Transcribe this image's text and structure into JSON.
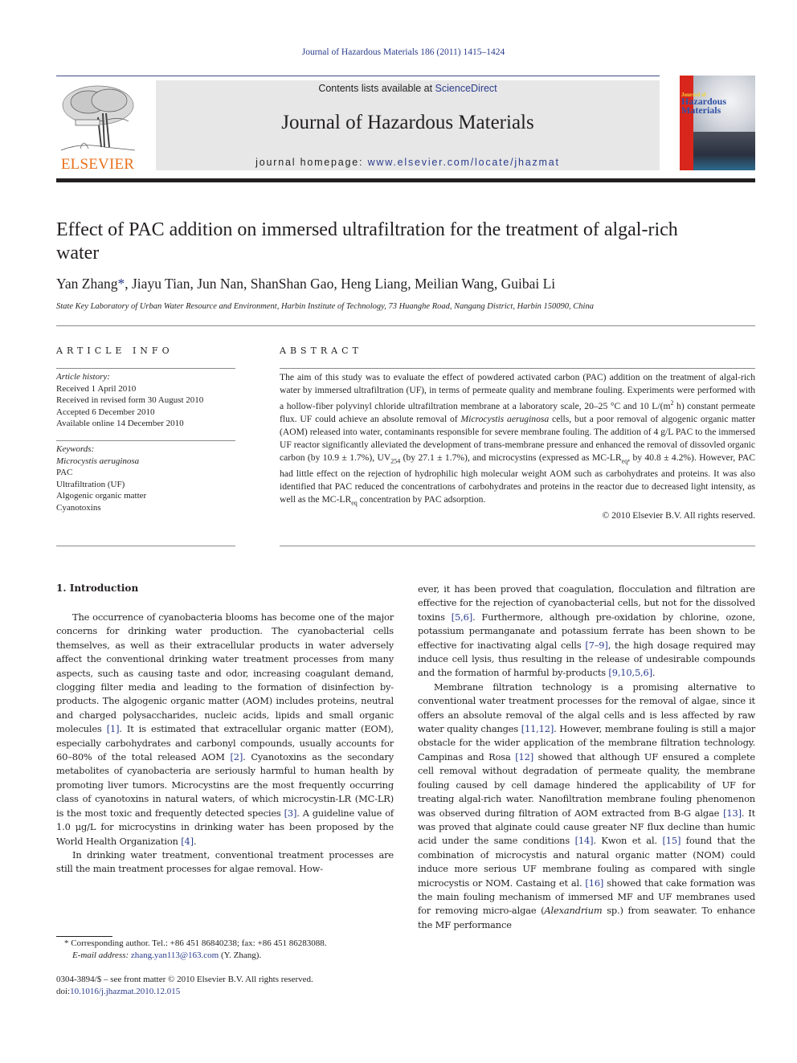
{
  "header": {
    "citation": "Journal of Hazardous Materials 186 (2011) 1415–1424",
    "contents_prefix": "Contents lists available at ",
    "contents_link": "ScienceDirect",
    "journal_title": "Journal of Hazardous Materials",
    "homepage_prefix": "journal homepage: ",
    "homepage_link": "www.elsevier.com/locate/jhazmat",
    "publisher_logo_text": "ELSEVIER",
    "cover": {
      "line1": "Journal of",
      "line2": "Hazardous",
      "line3": "Materials"
    },
    "colors": {
      "link": "#2a3c8c",
      "elsevier_orange": "#e9711c",
      "banner_gray": "#e7e7e7",
      "cover_red": "#d9261c"
    }
  },
  "article": {
    "title": "Effect of PAC addition on immersed ultrafiltration for the treatment of algal-rich water",
    "authors": [
      {
        "name": "Yan Zhang",
        "corresponding": true
      },
      {
        "name": "Jiayu Tian"
      },
      {
        "name": "Jun Nan"
      },
      {
        "name": "ShanShan Gao"
      },
      {
        "name": "Heng Liang"
      },
      {
        "name": "Meilian Wang"
      },
      {
        "name": "Guibai Li"
      }
    ],
    "corresponding_mark": "*",
    "affiliation": "State Key Laboratory of Urban Water Resource and Environment, Harbin Institute of Technology, 73 Huanghe Road, Nangang District, Harbin 150090, China"
  },
  "article_info": {
    "heading": "ARTICLE INFO",
    "history_label": "Article history:",
    "history": [
      "Received 1 April 2010",
      "Received in revised form 30 August 2010",
      "Accepted 6 December 2010",
      "Available online 14 December 2010"
    ],
    "keywords_label": "Keywords:",
    "keywords": [
      {
        "text": "Microcystis aeruginosa",
        "italic": true
      },
      {
        "text": "PAC"
      },
      {
        "text": "Ultrafiltration (UF)"
      },
      {
        "text": "Algogenic organic matter"
      },
      {
        "text": "Cyanotoxins"
      }
    ]
  },
  "abstract": {
    "heading": "ABSTRACT",
    "parts": {
      "p1": "The aim of this study was to evaluate the effect of powdered activated carbon (PAC) addition on the treatment of algal-rich water by immersed ultrafiltration (UF), in terms of permeate quality and membrane fouling. Experiments were performed with a hollow-fiber polyvinyl chloride ultrafiltration membrane at a laboratory scale, 20–25 °C and 10 L/(m",
      "sup2": "2",
      "p2": " h) constant permeate flux. UF could achieve an absolute removal of ",
      "species": "Microcystis aeruginosa",
      "p3": " cells, but a poor removal of algogenic organic matter (AOM) released into water, contaminants responsible for severe membrane fouling. The addition of 4 g/L PAC to the immersed UF reactor significantly alleviated the development of trans-membrane pressure and enhanced the removal of dissovled organic carbon (by 10.9 ± 1.7%), UV",
      "sub254": "254",
      "p4": " (by 27.1 ± 1.7%), and microcystins (expressed as MC-LR",
      "sub_eq1": "eq",
      "p5": ", by 40.8 ± 4.2%). However, PAC had little effect on the rejection of hydrophilic high molecular weight AOM such as carbohydrates and proteins. It was also identified that PAC reduced the concentrations of carbohydrates and proteins in the reactor due to decreased light intensity, as well as the MC-LR",
      "sub_eq2": "eq",
      "p6": " concentration by PAC adsorption."
    },
    "copyright": "© 2010 Elsevier B.V. All rights reserved."
  },
  "body": {
    "section_heading": "1.  Introduction",
    "left": {
      "p1_a": "The occurrence of cyanobacteria blooms has become one of the major concerns for drinking water production. The cyanobacterial cells themselves, as well as their extracellular products in water adversely affect the conventional drinking water treatment processes from many aspects, such as causing taste and odor, increasing coagulant demand, clogging filter media and leading to the formation of disinfection by-products. The algogenic organic matter (AOM) includes proteins, neutral and charged polysaccharides, nucleic acids, lipids and small organic molecules ",
      "ref1": "[1]",
      "p1_b": ". It is estimated that extracellular organic matter (EOM), especially carbohydrates and carbonyl compounds, usually accounts for 60–80% of the total released AOM ",
      "ref2": "[2]",
      "p1_c": ". Cyanotoxins as the secondary metabolites of cyanobacteria are seriously harmful to human health by promoting liver tumors. Microcystins are the most frequently occurring class of cyanotoxins in natural waters, of which microcystin-LR (MC-LR) is the most toxic and frequently detected species ",
      "ref3": "[3]",
      "p1_d": ". A guideline value of 1.0 μg/L for microcystins in drinking water has been proposed by the World Health Organization ",
      "ref4": "[4]",
      "p1_e": ".",
      "p2": "In drinking water treatment, conventional treatment processes are still the main treatment processes for algae removal. How-"
    },
    "right": {
      "p1_a": "ever, it has been proved that coagulation, flocculation and filtration are effective for the rejection of cyanobacterial cells, but not for the dissolved toxins ",
      "ref56": "[5,6]",
      "p1_b": ". Furthermore, although pre-oxidation by chlorine, ozone, potassium permanganate and potassium ferrate has been shown to be effective for inactivating algal cells ",
      "ref79": "[7–9]",
      "p1_c": ", the high dosage required may induce cell lysis, thus resulting in the release of undesirable compounds and the formation of harmful by-products ",
      "ref91056": "[9,10,5,6]",
      "p1_d": ".",
      "p2_a": "Membrane filtration technology is a promising alternative to conventional water treatment processes for the removal of algae, since it offers an absolute removal of the algal cells and is less affected by raw water quality changes ",
      "ref1112": "[11,12]",
      "p2_b": ". However, membrane fouling is still a major obstacle for the wider application of the membrane filtration technology. Campinas and Rosa ",
      "ref12": "[12]",
      "p2_c": " showed that although UF ensured a complete cell removal without degradation of permeate quality, the membrane fouling caused by cell damage hindered the applicability of UF for treating algal-rich water. Nanofiltration membrane fouling phenomenon was observed during filtration of AOM extracted from B-G algae ",
      "ref13": "[13]",
      "p2_d": ". It was proved that alginate could cause greater NF flux decline than humic acid under the same conditions ",
      "ref14": "[14]",
      "p2_e": ". Kwon et al. ",
      "ref15": "[15]",
      "p2_f": " found that the combination of microcystis and natural organic matter (NOM) could induce more serious UF membrane fouling as compared with single microcystis or NOM. Castaing et al. ",
      "ref16": "[16]",
      "p2_g": " showed that cake formation was the main fouling mechanism of immersed MF and UF membranes used for removing micro-algae (",
      "species": "Alexandrium",
      "p2_h": " sp.) from seawater. To enhance the MF performance"
    }
  },
  "footnote": {
    "mark": "*",
    "corresponding": " Corresponding author. Tel.: +86 451 86840238; fax: +86 451 86283088.",
    "email_label": "E-mail address:",
    "email": "zhang.yan113@163.com",
    "email_suffix": " (Y. Zhang)."
  },
  "front_matter": {
    "issn_line": "0304-3894/$ – see front matter © 2010 Elsevier B.V. All rights reserved.",
    "doi_prefix": "doi:",
    "doi": "10.1016/j.jhazmat.2010.12.015"
  }
}
